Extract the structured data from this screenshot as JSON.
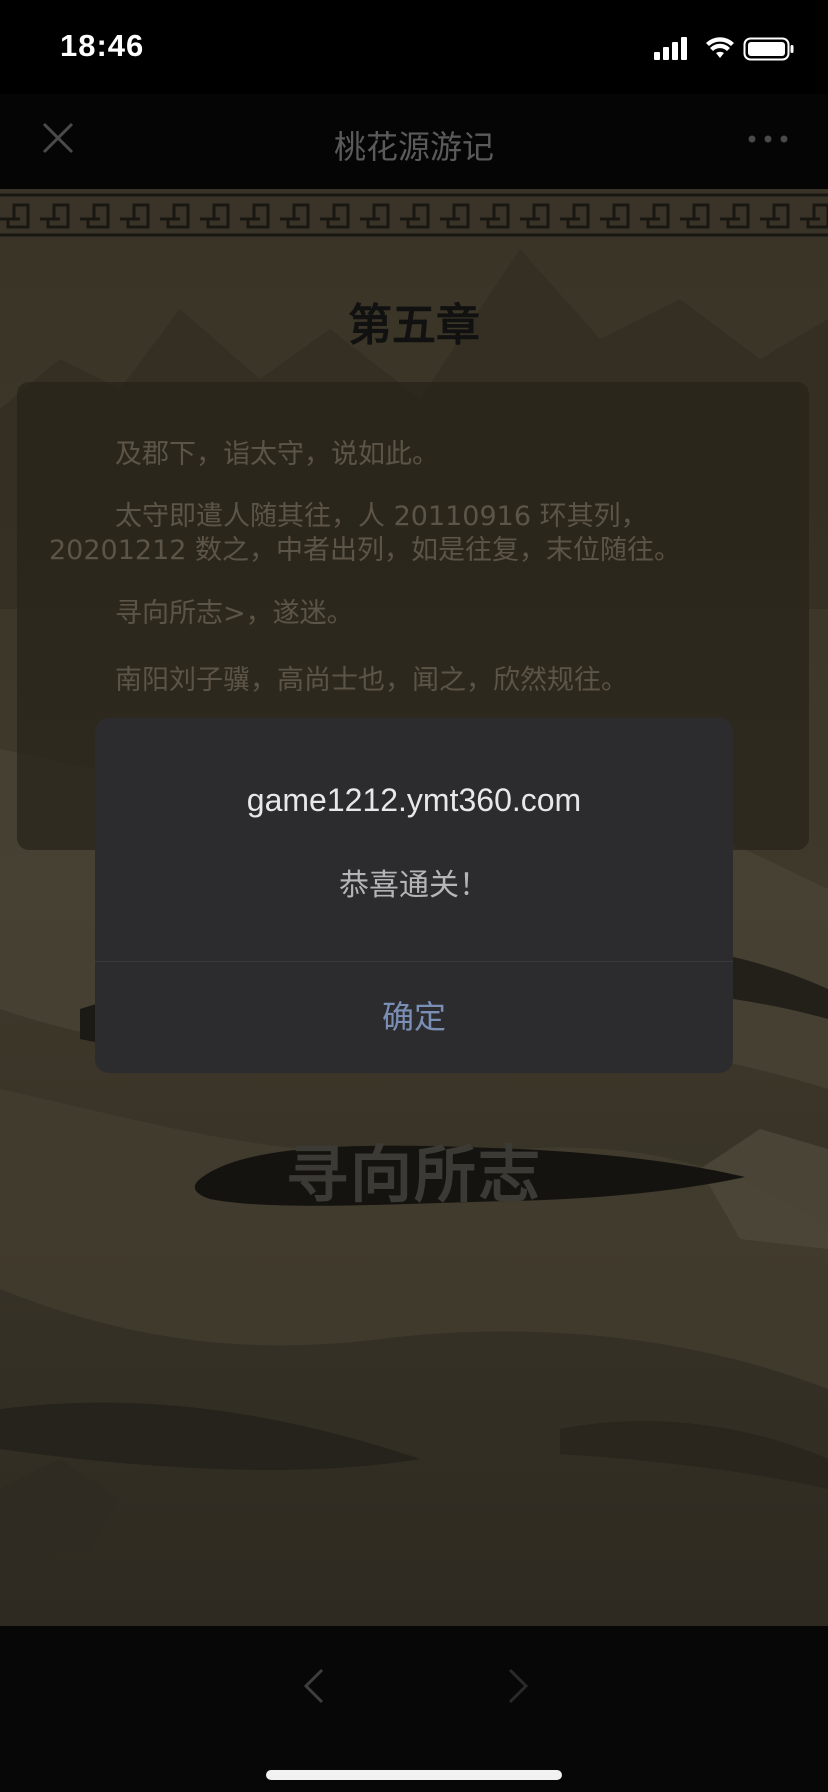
{
  "status_bar": {
    "time": "18:46",
    "icons": [
      "cellular-signal-icon",
      "wifi-icon",
      "battery-icon"
    ]
  },
  "nav": {
    "title": "桃花源游记",
    "close_icon": "close-icon",
    "more_icon": "more-icon"
  },
  "page": {
    "chapter_title": "第五章",
    "paragraphs": [
      "及郡下，诣太守，说如此。",
      "太守即遣人随其往，人 20110916 环其列，",
      "20201212 数之，中者出列，如是往复，末位随往。",
      "寻向所志>，遂迷。",
      "南阳刘子骥，高尚士也，闻之，欣然规往。"
    ],
    "bottom_title": "寻向所志"
  },
  "dialog": {
    "host": "game1212.ymt360.com",
    "message": "恭喜通关！",
    "ok_label": "确定"
  },
  "toolbar": {
    "back_icon": "chevron-left-icon",
    "forward_icon": "chevron-right-icon"
  },
  "colors": {
    "dialog_bg": "#2c2c2e",
    "dialog_button": "#7a8fb6",
    "page_bg": "#3b3527"
  }
}
